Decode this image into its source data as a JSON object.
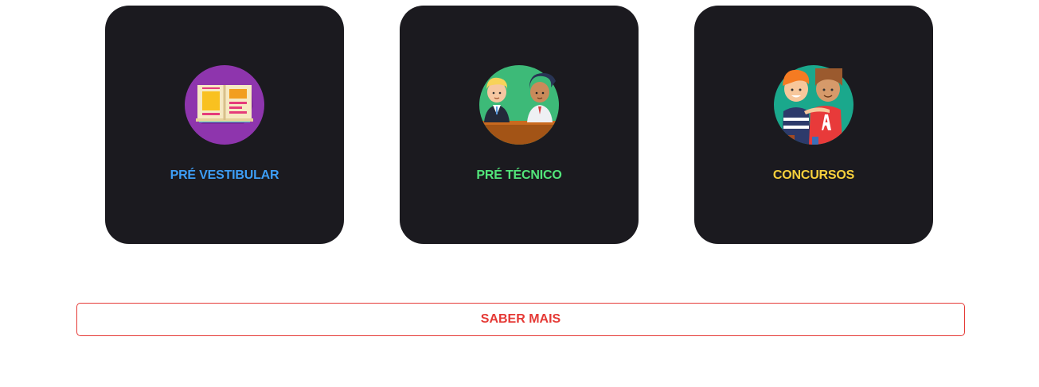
{
  "cards": [
    {
      "label": "PRÉ VESTIBULAR",
      "icon": "open-book-icon",
      "color": "#3d9df5"
    },
    {
      "label": "PRÉ TÉCNICO",
      "icon": "students-at-desk-icon",
      "color": "#52e57a"
    },
    {
      "label": "CONCURSOS",
      "icon": "two-people-icon",
      "color": "#f7d03c"
    }
  ],
  "cta": {
    "label": "SABER MAIS",
    "color": "#e53935"
  }
}
